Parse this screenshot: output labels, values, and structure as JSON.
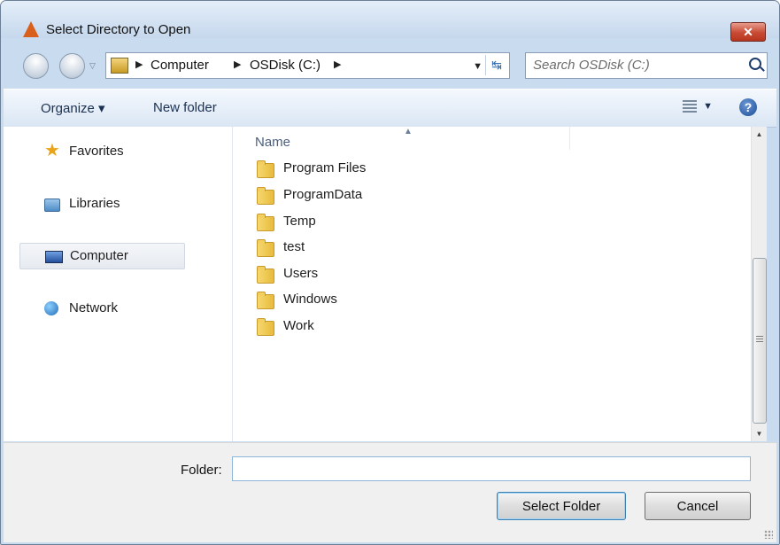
{
  "window": {
    "title": "Select Directory to Open",
    "close_label": "✕"
  },
  "navigation": {
    "breadcrumbs": [
      "Computer",
      "OSDisk (C:)"
    ],
    "search_placeholder": "Search OSDisk (C:)"
  },
  "toolbar": {
    "organize_label": "Organize ▾",
    "new_folder_label": "New folder",
    "help_label": "?"
  },
  "sidebar": {
    "items": [
      {
        "label": "Favorites",
        "icon": "star-icon"
      },
      {
        "label": "Libraries",
        "icon": "libraries-icon"
      },
      {
        "label": "Computer",
        "icon": "computer-icon",
        "selected": true
      },
      {
        "label": "Network",
        "icon": "network-icon"
      }
    ]
  },
  "content": {
    "column_header": "Name",
    "files": [
      "Program Files",
      "ProgramData",
      "Temp",
      "test",
      "Users",
      "Windows",
      "Work"
    ]
  },
  "bottom": {
    "folder_label": "Folder:",
    "folder_value": "",
    "select_button_label": "Select Folder",
    "cancel_button_label": "Cancel"
  },
  "colors": {
    "accent": "#c9dbef",
    "close": "#c84a33",
    "folder": "#e8bb3c"
  }
}
